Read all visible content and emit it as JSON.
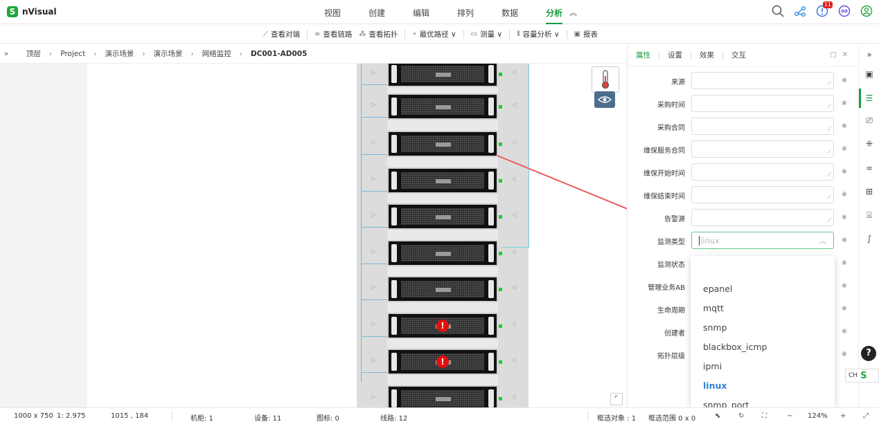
{
  "app": {
    "name": "nVisual",
    "logo_icon": "nvisual-logo-icon"
  },
  "menu": {
    "items": [
      {
        "label": "视图"
      },
      {
        "label": "创建"
      },
      {
        "label": "编辑"
      },
      {
        "label": "排列"
      },
      {
        "label": "数据"
      },
      {
        "label": "分析",
        "active": true
      }
    ],
    "collapse": "≈"
  },
  "top_icons": [
    {
      "name": "search-icon"
    },
    {
      "name": "share-icon"
    },
    {
      "name": "notification-icon",
      "badge": "11"
    },
    {
      "name": "settings-icon"
    },
    {
      "name": "user-icon"
    }
  ],
  "toolbar": {
    "items": [
      {
        "label": "查看对端",
        "icon": "endpoint-icon"
      },
      {
        "label": "查看链路",
        "icon": "link-icon"
      },
      {
        "label": "查看拓扑",
        "icon": "topology-icon"
      },
      {
        "label": "最优路径 ∨",
        "icon": "path-icon"
      },
      {
        "label": "测量 ∨",
        "icon": "measure-icon"
      },
      {
        "label": "容量分析 ∨",
        "icon": "capacity-icon"
      },
      {
        "label": "报表",
        "icon": "report-icon"
      }
    ]
  },
  "breadcrumb": [
    "顶层",
    "Project",
    "演示场景",
    "演示场景",
    "网络监控",
    "DC001-AD005"
  ],
  "canvas": {
    "devices_with_alert": [
      7,
      8
    ],
    "alert_symbol": "!"
  },
  "properties": {
    "tabs": [
      "属性",
      "设置",
      "效果",
      "交互"
    ],
    "active_tab": 0,
    "fields": [
      {
        "label": "来源"
      },
      {
        "label": "采购时间"
      },
      {
        "label": "采购合同"
      },
      {
        "label": "维保服务合同"
      },
      {
        "label": "维保开始时间"
      },
      {
        "label": "维保结束时间"
      },
      {
        "label": "告警源"
      },
      {
        "label": "监测类型",
        "type": "select",
        "placeholder": "linux"
      },
      {
        "label": "监测状态"
      },
      {
        "label": "管理业务AB"
      },
      {
        "label": "生命周期"
      },
      {
        "label": "创建者"
      },
      {
        "label": "拓扑层级"
      }
    ],
    "dropdown_options": [
      "epanel",
      "mqtt",
      "snmp",
      "blackbox_icmp",
      "ipmi",
      "linux",
      "snmp_port"
    ],
    "selected_option": "linux"
  },
  "status": {
    "canvas_size": "1000 x 750",
    "scale": "1: 2.975",
    "cursor": "1015 , 184",
    "racks": "机柜: 1",
    "devices": "设备: 11",
    "icons": "图标: 0",
    "lines": "线路: 12",
    "selected": "框选对象 : 1",
    "range": "框选范围 0 x 0",
    "zoom": "124%"
  },
  "ime": {
    "label": "CH",
    "icon": "S"
  },
  "colors": {
    "accent": "#1a9a3e",
    "selected_option": "#2e7fd6",
    "alert": "#e01010",
    "arrow": "#e85a5a"
  }
}
